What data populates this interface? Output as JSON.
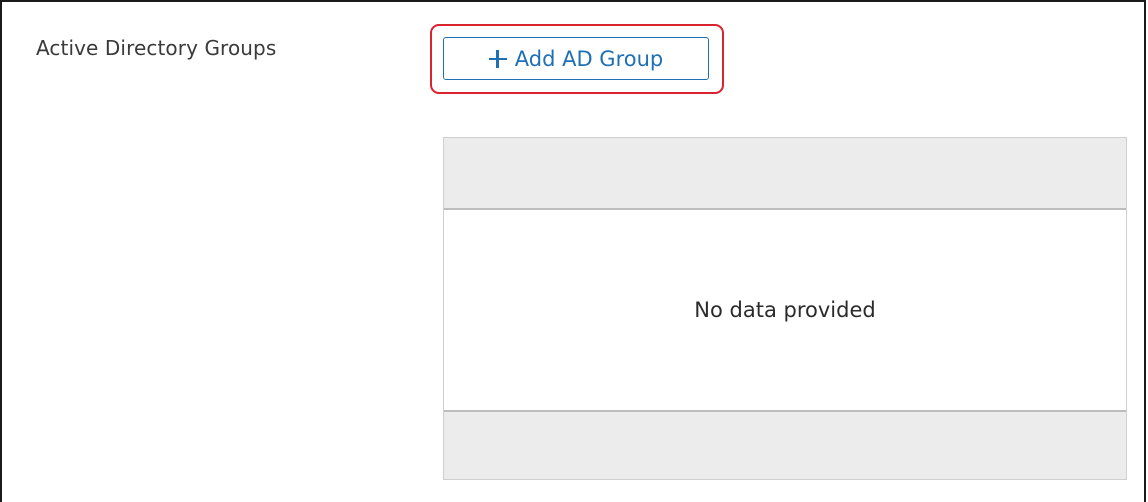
{
  "section": {
    "label": "Active Directory Groups"
  },
  "toolbar": {
    "add_button_label": "Add AD Group",
    "add_button_icon": "plus-icon"
  },
  "table": {
    "columns": [],
    "rows": [],
    "empty_message": "No data provided"
  },
  "colors": {
    "accent": "#1f6fb5",
    "highlight": "#d9232e",
    "table_header_bg": "#ececec"
  }
}
